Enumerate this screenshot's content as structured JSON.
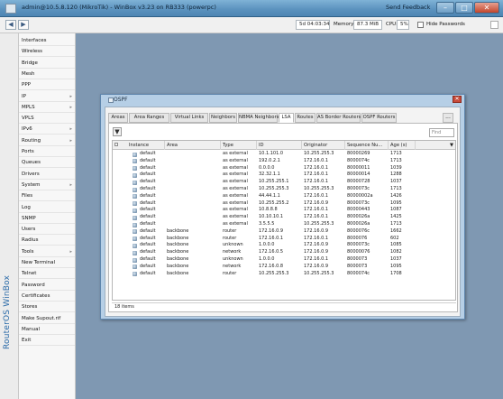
{
  "window": {
    "title": "admin@10.5.8.120 (MikroTik) - WinBox v3.23 on RB333 (powerpc)",
    "send_feedback": "Send Feedback",
    "minimize": "–",
    "maximize": "□",
    "close": "✕"
  },
  "toolbar": {
    "back": "◀",
    "forward": "▶",
    "uptime": "5d 04:03:34",
    "memory_label": "Memory:",
    "memory": "87.3 MiB",
    "cpu_label": "CPU:",
    "cpu": "5%",
    "hide_passwords": "Hide Passwords"
  },
  "brand": {
    "logo": "RouterOS WinBox"
  },
  "menu": {
    "items": [
      {
        "label": "Interfaces",
        "arrow": ""
      },
      {
        "label": "Wireless",
        "arrow": ""
      },
      {
        "label": "Bridge",
        "arrow": ""
      },
      {
        "label": "Mesh",
        "arrow": ""
      },
      {
        "label": "PPP",
        "arrow": ""
      },
      {
        "label": "IP",
        "arrow": "▸"
      },
      {
        "label": "MPLS",
        "arrow": "▸"
      },
      {
        "label": "VPLS",
        "arrow": ""
      },
      {
        "label": "IPv6",
        "arrow": "▸"
      },
      {
        "label": "Routing",
        "arrow": "▸"
      },
      {
        "label": "Ports",
        "arrow": ""
      },
      {
        "label": "Queues",
        "arrow": ""
      },
      {
        "label": "Drivers",
        "arrow": ""
      },
      {
        "label": "System",
        "arrow": "▸"
      },
      {
        "label": "Files",
        "arrow": ""
      },
      {
        "label": "Log",
        "arrow": ""
      },
      {
        "label": "SNMP",
        "arrow": ""
      },
      {
        "label": "Users",
        "arrow": ""
      },
      {
        "label": "Radius",
        "arrow": ""
      },
      {
        "label": "Tools",
        "arrow": "▸"
      },
      {
        "label": "New Terminal",
        "arrow": ""
      },
      {
        "label": "Telnet",
        "arrow": ""
      },
      {
        "label": "Password",
        "arrow": ""
      },
      {
        "label": "Certificates",
        "arrow": ""
      },
      {
        "label": "Stores",
        "arrow": ""
      },
      {
        "label": "Make Supout.rif",
        "arrow": ""
      },
      {
        "label": "Manual",
        "arrow": ""
      },
      {
        "label": "Exit",
        "arrow": ""
      }
    ]
  },
  "ospf": {
    "title": "OSPF",
    "close": "✕",
    "tabs": [
      "Areas",
      "Area Ranges",
      "Virtual Links",
      "Neighbors",
      "NBMA Neighbors",
      "LSA",
      "Routes",
      "AS Border Routers",
      "OSPF Routers"
    ],
    "active_tab": "LSA",
    "more": "...",
    "filter": "▼",
    "find_placeholder": "Find",
    "columns": [
      "Instance",
      "Area",
      "Type",
      "ID",
      "Originator",
      "Sequence Nu...",
      "Age (s)"
    ],
    "rows": [
      [
        "default",
        "",
        "as external",
        "10.1.101.0",
        "10.255.255.3",
        "80000269",
        "1713"
      ],
      [
        "default",
        "",
        "as external",
        "192.0.2.1",
        "172.16.0.1",
        "8000074c",
        "1713"
      ],
      [
        "default",
        "",
        "as external",
        "0.0.0.0",
        "172.16.0.1",
        "80000011",
        "1039"
      ],
      [
        "default",
        "",
        "as external",
        "32.32.1.1",
        "172.16.0.1",
        "80000014",
        "1288"
      ],
      [
        "default",
        "",
        "as external",
        "10.255.255.1",
        "172.16.0.1",
        "80000728",
        "1037"
      ],
      [
        "default",
        "",
        "as external",
        "10.255.255.3",
        "10.255.255.3",
        "8000073c",
        "1713"
      ],
      [
        "default",
        "",
        "as external",
        "44.44.1.1",
        "172.16.0.1",
        "80000002a",
        "1426"
      ],
      [
        "default",
        "",
        "as external",
        "10.255.255.2",
        "172.16.0.9",
        "8000073c",
        "1095"
      ],
      [
        "default",
        "",
        "as external",
        "10.8.8.8",
        "172.16.0.1",
        "80000443",
        "1087"
      ],
      [
        "default",
        "",
        "as external",
        "10.10.10.1",
        "172.16.0.1",
        "8000026a",
        "1425"
      ],
      [
        "default",
        "",
        "as external",
        "3.5.5.5",
        "10.255.255.3",
        "8000026a",
        "1713"
      ],
      [
        "default",
        "backbone",
        "router",
        "172.16.0.9",
        "172.16.0.9",
        "8000076c",
        "1662"
      ],
      [
        "default",
        "backbone",
        "router",
        "172.16.0.1",
        "172.16.0.1",
        "8000076",
        "602"
      ],
      [
        "default",
        "backbone",
        "unknown",
        "1.0.0.0",
        "172.16.0.9",
        "8000073c",
        "1085"
      ],
      [
        "default",
        "backbone",
        "network",
        "172.16.0.5",
        "172.16.0.9",
        "80000076",
        "1082"
      ],
      [
        "default",
        "backbone",
        "unknown",
        "1.0.0.0",
        "172.16.0.1",
        "8000073",
        "1037"
      ],
      [
        "default",
        "backbone",
        "network",
        "172.16.0.8",
        "172.16.0.9",
        "8000073",
        "1095"
      ],
      [
        "default",
        "backbone",
        "router",
        "10.255.255.3",
        "10.255.255.3",
        "8000074c",
        "1708"
      ]
    ],
    "status": "18 items"
  }
}
